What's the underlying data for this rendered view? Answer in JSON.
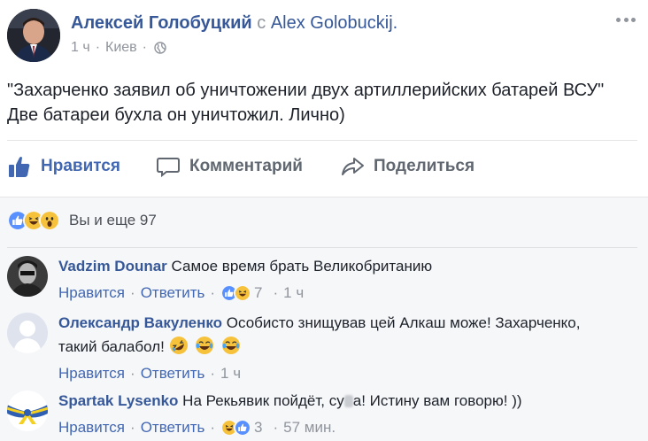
{
  "post": {
    "author_name": "Алексей Голобуцкий",
    "with_word": "с",
    "tagged_name": "Alex Golobuckij.",
    "time": "1 ч",
    "location": "Киев",
    "text_line1": "\"Захарченко заявил об уничтожении двух артиллерийских батарей ВСУ\"",
    "text_line2": "Две батареи бухла он уничтожил. Лично)"
  },
  "actions": {
    "like_label": "Нравится",
    "comment_label": "Комментарий",
    "share_label": "Поделиться"
  },
  "reactions": {
    "summary": "Вы и еще 97",
    "icons": [
      "like-reaction",
      "haha-reaction",
      "wow-reaction"
    ]
  },
  "comments": [
    {
      "author": "Vadzim Dounar",
      "text": "Самое время брать Великобританию",
      "like_label": "Нравится",
      "reply_label": "Ответить",
      "reaction_count": "7",
      "time": "1 ч"
    },
    {
      "author": "Олександр Вакуленко",
      "text_line1": "Особисто знищував цей Алкаш може! Захарченко,",
      "text_line2": "такий балабол!",
      "emojis": [
        "rolling-laugh-emoji",
        "tears-of-joy-emoji",
        "tears-of-joy-emoji"
      ],
      "like_label": "Нравится",
      "reply_label": "Ответить",
      "time": "1 ч"
    },
    {
      "author": "Spartak Lysenko",
      "text_before": "На Рекьявик пойдёт, су",
      "text_after": "а! Истину вам говорю! ))",
      "like_label": "Нравится",
      "reply_label": "Ответить",
      "reaction_count": "3",
      "time": "57 мин."
    }
  ],
  "separator": "·",
  "colors": {
    "link_blue": "#365899",
    "action_blue": "#4267b2",
    "meta_grey": "#90949c",
    "comments_bg": "#f6f7f9",
    "like_blue": "#5890ff",
    "emoji_yellow": "#f7c23b"
  }
}
